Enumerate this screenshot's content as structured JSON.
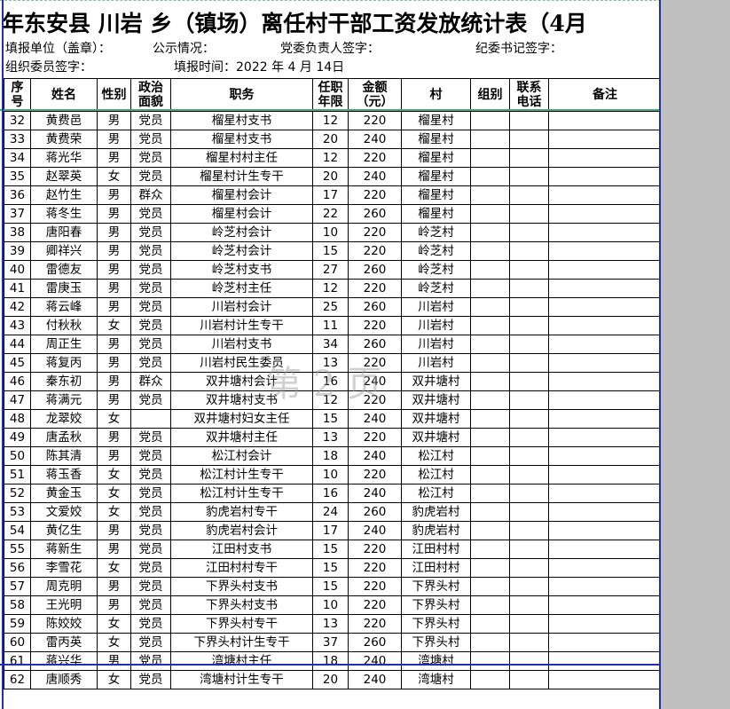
{
  "title": "年东安县 川岩 乡（镇场）离任村干部工资发放统计表（4月",
  "info": {
    "unit": "填报单位（盖章）：",
    "publicity": "公示情况：",
    "party_sign": "党委负责人签字：",
    "discipline_sign": "纪委书记签字：",
    "org_sign": "组织委员签字：",
    "fill_time": "填报时间：2022 年  4  月 14日"
  },
  "headers": {
    "seq": "序\n号",
    "name": "姓名",
    "sex": "性别",
    "politics": "政治\n面貌",
    "position": "职务",
    "years": "任职\n年限",
    "amount": "金额\n（元）",
    "village": "村",
    "group": "组别",
    "phone": "联系\n电话",
    "remark": "备注"
  },
  "watermark": "第 2 页",
  "rows": [
    {
      "seq": "32",
      "name": "黄费邑",
      "sex": "男",
      "politics": "党员",
      "position": "榴星村支书",
      "years": "12",
      "amount": "220",
      "village": "榴星村"
    },
    {
      "seq": "33",
      "name": "黄费荣",
      "sex": "男",
      "politics": "党员",
      "position": "榴星村支书",
      "years": "20",
      "amount": "240",
      "village": "榴星村"
    },
    {
      "seq": "34",
      "name": "蒋光华",
      "sex": "男",
      "politics": "党员",
      "position": "榴星村村主任",
      "years": "12",
      "amount": "220",
      "village": "榴星村"
    },
    {
      "seq": "35",
      "name": "赵翠英",
      "sex": "女",
      "politics": "党员",
      "position": "榴星村计生专干",
      "years": "20",
      "amount": "240",
      "village": "榴星村"
    },
    {
      "seq": "36",
      "name": "赵竹生",
      "sex": "男",
      "politics": "群众",
      "position": "榴星村会计",
      "years": "17",
      "amount": "220",
      "village": "榴星村"
    },
    {
      "seq": "37",
      "name": "蒋冬生",
      "sex": "男",
      "politics": "党员",
      "position": "榴星村会计",
      "years": "22",
      "amount": "260",
      "village": "榴星村"
    },
    {
      "seq": "38",
      "name": "唐阳春",
      "sex": "男",
      "politics": "党员",
      "position": "岭芝村会计",
      "years": "10",
      "amount": "220",
      "village": "岭芝村"
    },
    {
      "seq": "39",
      "name": "卿祥兴",
      "sex": "男",
      "politics": "党员",
      "position": "岭芝村会计",
      "years": "15",
      "amount": "220",
      "village": "岭芝村"
    },
    {
      "seq": "40",
      "name": "雷德友",
      "sex": "男",
      "politics": "党员",
      "position": "岭芝村支书",
      "years": "27",
      "amount": "260",
      "village": "岭芝村"
    },
    {
      "seq": "41",
      "name": "雷庚玉",
      "sex": "男",
      "politics": "党员",
      "position": "岭芝村主任",
      "years": "12",
      "amount": "220",
      "village": "岭芝村"
    },
    {
      "seq": "42",
      "name": "蒋云峰",
      "sex": "男",
      "politics": "党员",
      "position": "川岩村会计",
      "years": "25",
      "amount": "260",
      "village": "川岩村"
    },
    {
      "seq": "43",
      "name": "付秋秋",
      "sex": "女",
      "politics": "党员",
      "position": "川岩村计生专干",
      "years": "11",
      "amount": "220",
      "village": "川岩村"
    },
    {
      "seq": "44",
      "name": "周正生",
      "sex": "男",
      "politics": "党员",
      "position": "川岩村支书",
      "years": "34",
      "amount": "260",
      "village": "川岩村"
    },
    {
      "seq": "45",
      "name": "蒋复丙",
      "sex": "男",
      "politics": "党员",
      "position": "川岩村民生委员",
      "years": "13",
      "amount": "220",
      "village": "川岩村"
    },
    {
      "seq": "46",
      "name": "秦东初",
      "sex": "男",
      "politics": "群众",
      "position": "双井塘村会计",
      "years": "16",
      "amount": "240",
      "village": "双井塘村"
    },
    {
      "seq": "47",
      "name": "蒋满元",
      "sex": "男",
      "politics": "党员",
      "position": "双井塘村支书",
      "years": "12",
      "amount": "220",
      "village": "双井塘村"
    },
    {
      "seq": "48",
      "name": "龙翠姣",
      "sex": "女",
      "politics": "",
      "position": "双井塘村妇女主任",
      "years": "15",
      "amount": "240",
      "village": "双井塘村"
    },
    {
      "seq": "49",
      "name": "唐孟秋",
      "sex": "男",
      "politics": "党员",
      "position": "双井塘村主任",
      "years": "13",
      "amount": "220",
      "village": "双井塘村"
    },
    {
      "seq": "50",
      "name": "陈其清",
      "sex": "男",
      "politics": "党员",
      "position": "松江村会计",
      "years": "18",
      "amount": "240",
      "village": "松江村"
    },
    {
      "seq": "51",
      "name": "蒋玉香",
      "sex": "女",
      "politics": "党员",
      "position": "松江村计生专干",
      "years": "10",
      "amount": "220",
      "village": "松江村"
    },
    {
      "seq": "52",
      "name": "黄金玉",
      "sex": "女",
      "politics": "党员",
      "position": "松江村计生专干",
      "years": "16",
      "amount": "240",
      "village": "松江村"
    },
    {
      "seq": "53",
      "name": "文爱姣",
      "sex": "女",
      "politics": "党员",
      "position": "豹虎岩村专干",
      "years": "24",
      "amount": "260",
      "village": "豹虎岩村"
    },
    {
      "seq": "54",
      "name": "黄亿生",
      "sex": "男",
      "politics": "党员",
      "position": "豹虎岩村会计",
      "years": "17",
      "amount": "240",
      "village": "豹虎岩村"
    },
    {
      "seq": "55",
      "name": "蒋新生",
      "sex": "男",
      "politics": "党员",
      "position": "江田村支书",
      "years": "15",
      "amount": "220",
      "village": "江田村村"
    },
    {
      "seq": "56",
      "name": "李雪花",
      "sex": "女",
      "politics": "党员",
      "position": "江田村村专干",
      "years": "15",
      "amount": "220",
      "village": "江田村村"
    },
    {
      "seq": "57",
      "name": "周克明",
      "sex": "男",
      "politics": "党员",
      "position": "下界头村支书",
      "years": "15",
      "amount": "220",
      "village": "下界头村"
    },
    {
      "seq": "58",
      "name": "王光明",
      "sex": "男",
      "politics": "党员",
      "position": "下界头村支书",
      "years": "10",
      "amount": "220",
      "village": "下界头村"
    },
    {
      "seq": "59",
      "name": "陈姣姣",
      "sex": "女",
      "politics": "党员",
      "position": "下界头村专干",
      "years": "13",
      "amount": "220",
      "village": "下界头村"
    },
    {
      "seq": "60",
      "name": "雷丙英",
      "sex": "女",
      "politics": "党员",
      "position": "下界头村计生专干",
      "years": "37",
      "amount": "260",
      "village": "下界头村"
    },
    {
      "seq": "61",
      "name": "蒋兴华",
      "sex": "男",
      "politics": "党员",
      "position": "湾塘村主任",
      "years": "18",
      "amount": "240",
      "village": "湾塘村"
    },
    {
      "seq": "62",
      "name": "唐顺秀",
      "sex": "女",
      "politics": "党员",
      "position": "湾塘村计生专干",
      "years": "20",
      "amount": "240",
      "village": "湾塘村"
    }
  ]
}
